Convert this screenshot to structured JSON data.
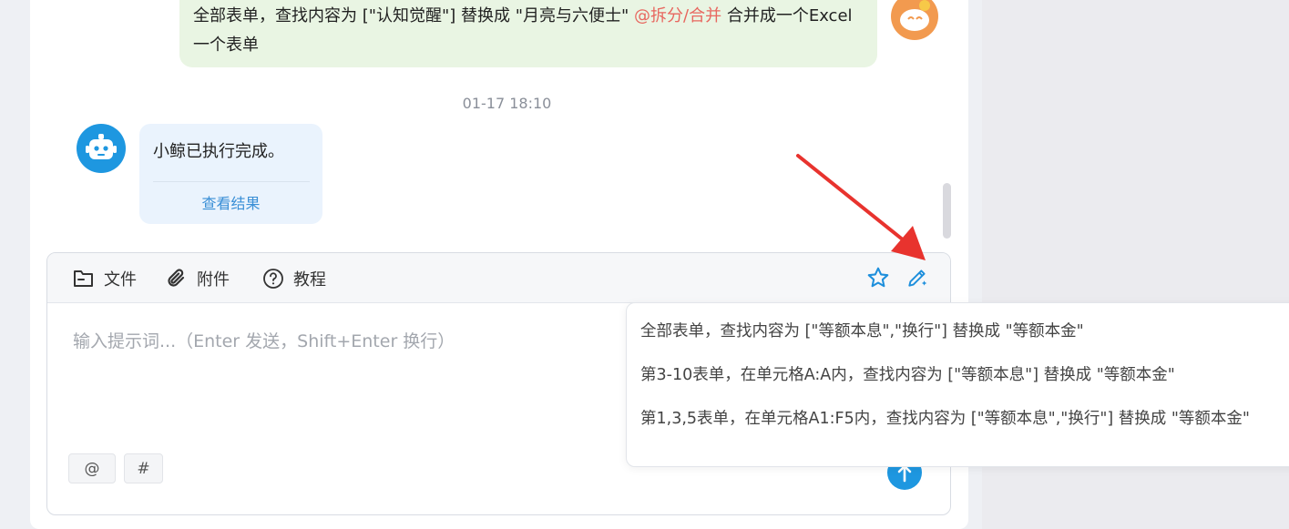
{
  "conversation": {
    "user_message": {
      "text_before": "全部表单，查找内容为 [\"认知觉醒\"] 替换成 \"月亮与六便士\" ",
      "mention": "@拆分/合并",
      "text_after": " 合并成一个Excel一个表单"
    },
    "timestamp": "01-17 18:10",
    "bot_message": {
      "text": "小鲸已执行完成。",
      "link_label": "查看结果"
    }
  },
  "toolbar": {
    "file_label": "文件",
    "attach_label": "附件",
    "tutorial_label": "教程"
  },
  "input": {
    "placeholder": "输入提示词...（Enter 发送，Shift+Enter 换行）",
    "value": ""
  },
  "chips": {
    "at": "@",
    "hash": "#"
  },
  "suggestions": [
    "全部表单，查找内容为 [\"等额本息\",\"换行\"] 替换成 \"等额本金\"",
    "第3-10表单，在单元格A:A内，查找内容为 [\"等额本息\"] 替换成 \"等额本金\"",
    "第1,3,5表单，在单元格A1:F5内，查找内容为 [\"等额本息\",\"换行\"] 替换成 \"等额本金\""
  ],
  "colors": {
    "accent": "#1e97e0",
    "mention": "#e8675f",
    "user_bubble": "#e9f5e3",
    "bot_bubble": "#eaf3fd",
    "annotation_arrow": "#e8332e"
  },
  "icons": {
    "file": "folder-icon",
    "attach": "paperclip-icon",
    "tutorial": "question-circle-icon",
    "favorite": "star-icon",
    "magic": "magic-pen-icon",
    "send": "send-arrow-icon"
  }
}
